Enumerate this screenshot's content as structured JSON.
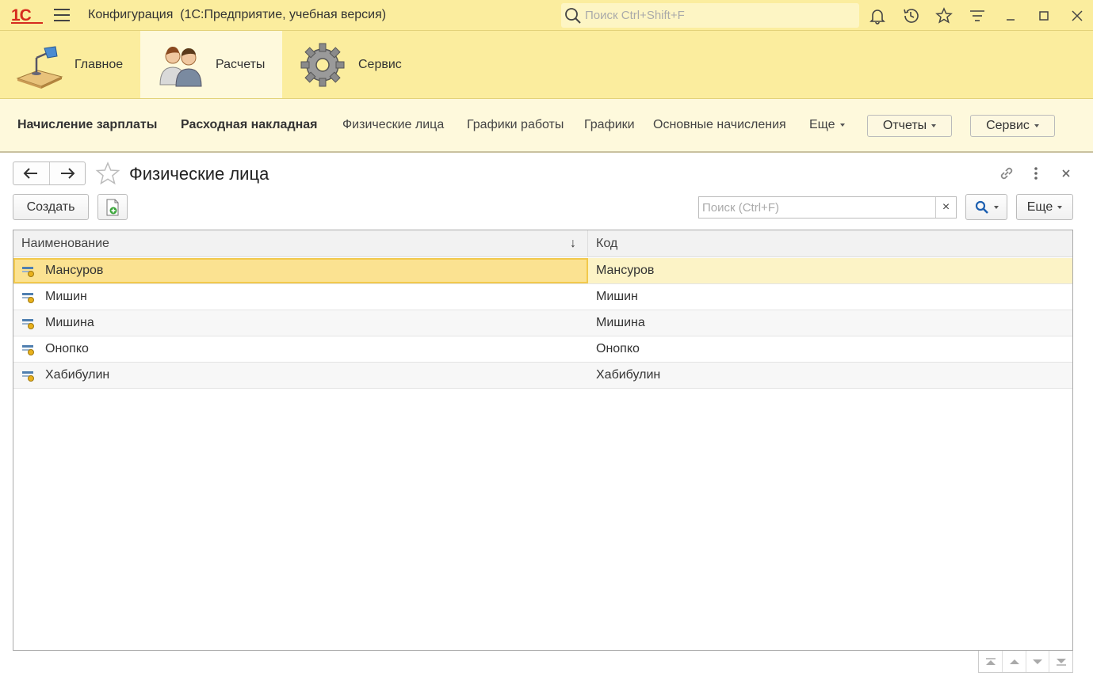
{
  "titlebar": {
    "logo": "1С",
    "title": "Конфигурация  (1С:Предприятие, учебная версия)",
    "search_placeholder": "Поиск Ctrl+Shift+F"
  },
  "sections": [
    {
      "label": "Главное",
      "icon": "desk-lamp-icon",
      "active": false
    },
    {
      "label": "Расчеты",
      "icon": "people-icon",
      "active": true
    },
    {
      "label": "Сервис",
      "icon": "gear-icon",
      "active": false
    }
  ],
  "functions": {
    "links": [
      {
        "label": "Начисление зарплаты",
        "bold": true
      },
      {
        "label": "Расходная накладная",
        "bold": true
      },
      {
        "label": "Физические лица",
        "bold": false
      },
      {
        "label": "Графики работы",
        "bold": false
      },
      {
        "label": "Графики",
        "bold": false
      },
      {
        "label": "Основные начисления",
        "bold": false
      }
    ],
    "more_label": "Еще",
    "reports_label": "Отчеты",
    "service_label": "Сервис"
  },
  "form": {
    "title": "Физические лица",
    "create_label": "Создать",
    "search_placeholder": "Поиск (Ctrl+F)",
    "search_clear": "×",
    "more_label": "Еще"
  },
  "table": {
    "columns": [
      "Наименование",
      "Код"
    ],
    "sort_indicator": "↓",
    "rows": [
      {
        "name": "Мансуров",
        "code": "Мансуров"
      },
      {
        "name": "Мишин",
        "code": "Мишин"
      },
      {
        "name": "Мишина",
        "code": "Мишина"
      },
      {
        "name": "Онопко",
        "code": "Онопко"
      },
      {
        "name": "Хабибулин",
        "code": "Хабибулин"
      }
    ],
    "selected_row": 0
  },
  "colors": {
    "header_bg": "#fbed9e",
    "panel_bg": "#fef9dc",
    "selection": "#fbe291"
  }
}
